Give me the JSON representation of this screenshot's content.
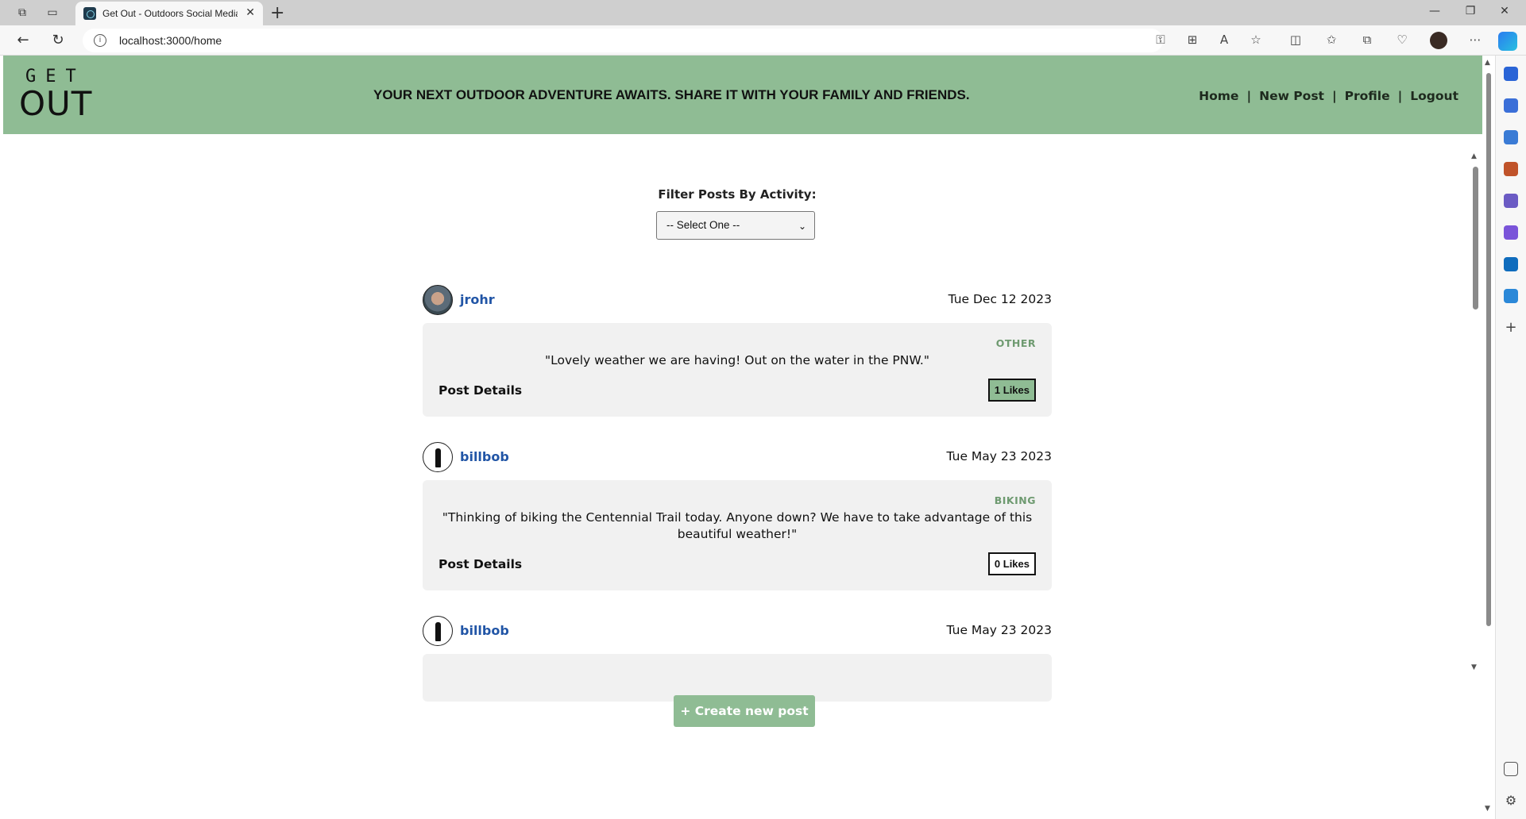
{
  "browser": {
    "tab_title": "Get Out - Outdoors Social Media",
    "url": "localhost:3000/home",
    "new_tab_symbol": "+"
  },
  "header": {
    "logo_top": "GET",
    "logo_bottom": "OUT",
    "tagline": "YOUR NEXT OUTDOOR ADVENTURE AWAITS. SHARE IT WITH YOUR FAMILY AND FRIENDS.",
    "nav": {
      "home": "Home",
      "new_post": "New Post",
      "profile": "Profile",
      "logout": "Logout",
      "separator": "|"
    },
    "background_color": "#8fbc94"
  },
  "filter": {
    "label": "Filter Posts By Activity:",
    "selected": "-- Select One --"
  },
  "posts": [
    {
      "username": "jrohr",
      "date": "Tue Dec 12 2023",
      "activity": "OTHER",
      "text": "\"Lovely weather we are having! Out on the water in the PNW.\"",
      "details_label": "Post Details",
      "likes_label": "1 Likes"
    },
    {
      "username": "billbob",
      "date": "Tue May 23 2023",
      "activity": "BIKING",
      "text": "\"Thinking of biking the Centennial Trail today. Anyone down? We have to take advantage of this beautiful weather!\"",
      "details_label": "Post Details",
      "likes_label": "0 Likes"
    },
    {
      "username": "billbob",
      "date": "Tue May 23 2023"
    }
  ],
  "create_button": "+ Create new post",
  "colors": {
    "accent": "#8fbc94",
    "username": "#2155a6",
    "activity": "#6e9a70"
  }
}
